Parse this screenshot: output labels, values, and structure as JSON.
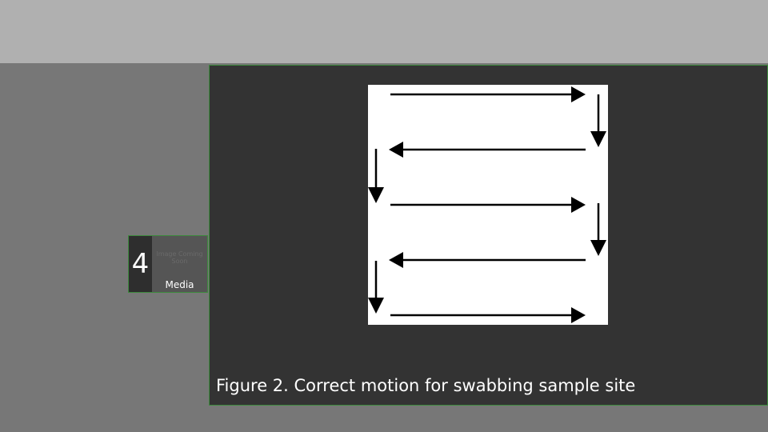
{
  "slide_thumbnail": {
    "number": "4",
    "placeholder_text": "Image Coming Soon",
    "label": "Media"
  },
  "figure": {
    "caption": "Figure 2. Correct motion for swabbing sample site",
    "arrow_color": "#000000",
    "image_background": "#ffffff"
  },
  "colors": {
    "top_bar": "#b0b0b0",
    "background": "#777777",
    "panel": "#333333",
    "panel_border": "#3d8a3d"
  }
}
